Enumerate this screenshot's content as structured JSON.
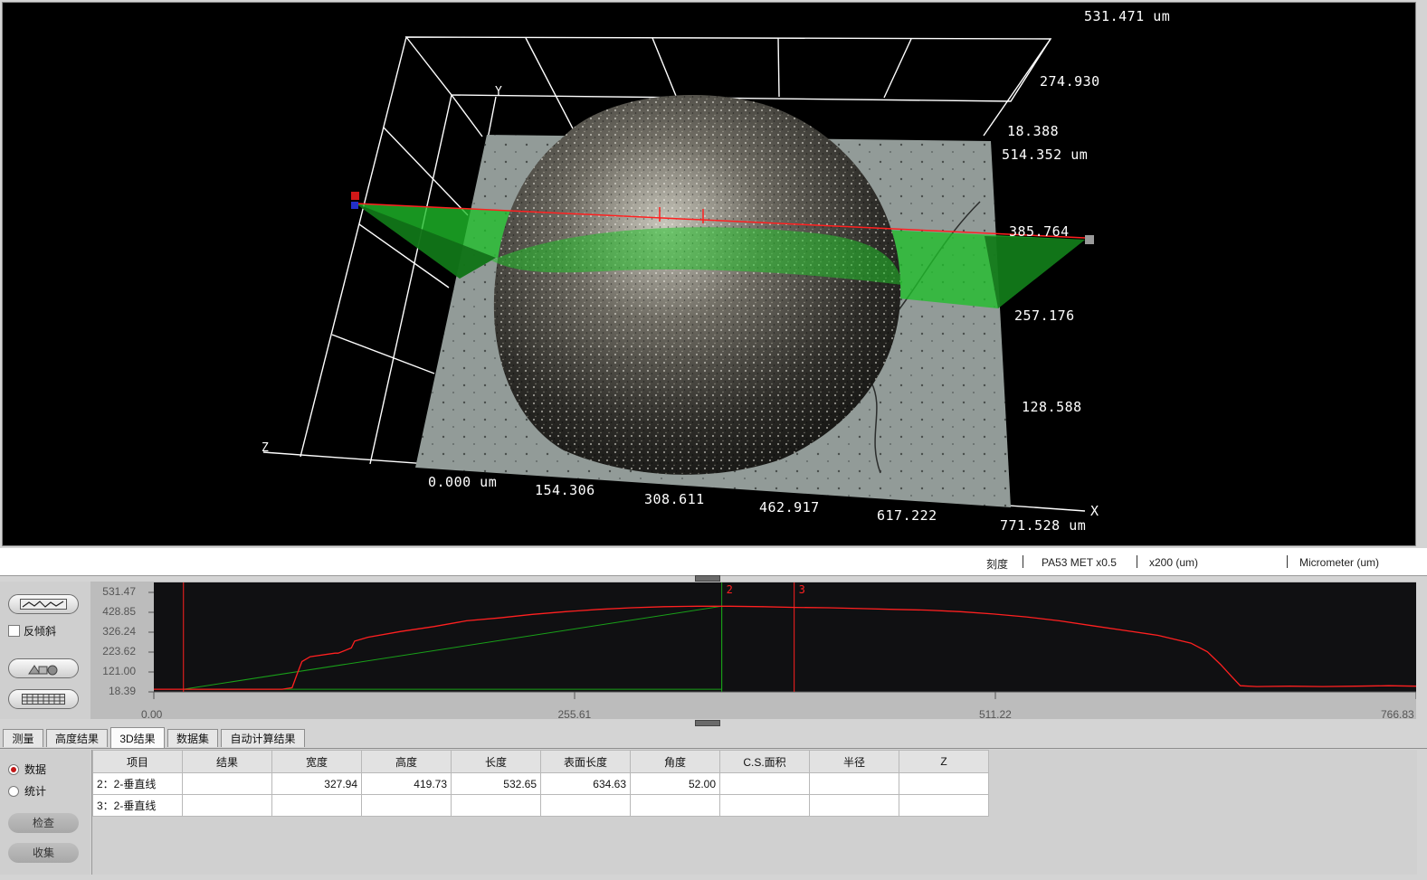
{
  "viewport": {
    "labels": {
      "z_top": "531.471 um",
      "z_274": "274.930",
      "y_18": "18.388",
      "y_514": "514.352 um",
      "y_385": "385.764",
      "y_257": "257.176",
      "y_128": "128.588",
      "x_0": "0.000 um",
      "x_154": "154.306",
      "x_308": "308.611",
      "x_462": "462.917",
      "x_617": "617.222",
      "x_771": "771.528 um",
      "axis_x": "X",
      "axis_y": "Y",
      "axis_z": "Z"
    },
    "colors": {
      "grid": "#ffffff",
      "plane": "#22c02a",
      "profile_line": "#ff2020",
      "surface": "#8f9a96"
    },
    "cursor_markers": [
      "2",
      "3"
    ]
  },
  "statusbar": {
    "mode": "刻度",
    "lens": "PA53 MET x0.5",
    "zoom": "x200 (um)",
    "unit": "Micrometer (um)"
  },
  "profile_panel": {
    "invert_tilt_label": "反倾斜",
    "invert_tilt_checked": false,
    "tool_icons": [
      "profile-wave-icon",
      "3d-shapes-icon",
      "grid-pattern-icon"
    ]
  },
  "chart_data": {
    "type": "line",
    "title": "",
    "xlabel": "",
    "ylabel": "",
    "x_ticks": [
      "0.00",
      "255.61",
      "511.22",
      "766.83"
    ],
    "y_ticks": [
      "531.47",
      "428.85",
      "326.24",
      "223.62",
      "121.00",
      "18.39"
    ],
    "xlim": [
      0,
      766.83
    ],
    "ylim": [
      18.39,
      531.47
    ],
    "grid": false,
    "series": [
      {
        "color": "#ff2020",
        "x": [
          0,
          18,
          78,
          84,
          87,
          90,
          95,
          110,
          112,
          120,
          122,
          130,
          150,
          170,
          190,
          210,
          230,
          250,
          270,
          290,
          310,
          330,
          350,
          370,
          390,
          410,
          430,
          450,
          470,
          490,
          510,
          530,
          550,
          570,
          590,
          610,
          630,
          640,
          648,
          655,
          660,
          670,
          690,
          710,
          730,
          750,
          766.83
        ],
        "y": [
          32,
          32,
          32,
          40,
          110,
          175,
          200,
          218,
          218,
          245,
          280,
          300,
          330,
          355,
          385,
          400,
          418,
          432,
          444,
          452,
          458,
          460,
          460,
          458,
          454,
          452,
          448,
          444,
          440,
          432,
          420,
          405,
          385,
          360,
          335,
          310,
          270,
          225,
          160,
          95,
          50,
          46,
          48,
          46,
          48,
          50,
          48
        ]
      }
    ],
    "reference_line": {
      "color": "#19a019",
      "x": [
        18,
        345
      ],
      "y": [
        32,
        460
      ]
    },
    "cursors": [
      {
        "label": "2",
        "x": 345
      },
      {
        "label": "3",
        "x": 389
      }
    ],
    "left_marker_x": 18
  },
  "tabs": [
    "测量",
    "高度结果",
    "3D结果",
    "数据集",
    "自动计算结果"
  ],
  "active_tab": "3D结果",
  "bottom_panel": {
    "radios": [
      "数据",
      "统计"
    ],
    "selected_radio": "数据",
    "buttons": {
      "check": "检查",
      "collect": "收集"
    }
  },
  "table": {
    "columns": [
      "项目",
      "结果",
      "宽度",
      "高度",
      "长度",
      "表面长度",
      "角度",
      "C.S.面积",
      "半径",
      "Z"
    ],
    "rows": [
      [
        "2：2-垂直线",
        "",
        "327.94",
        "419.73",
        "532.65",
        "634.63",
        "52.00",
        "",
        "",
        ""
      ],
      [
        "3：2-垂直线",
        "",
        "",
        "",
        "",
        "",
        "",
        "",
        "",
        ""
      ]
    ]
  }
}
